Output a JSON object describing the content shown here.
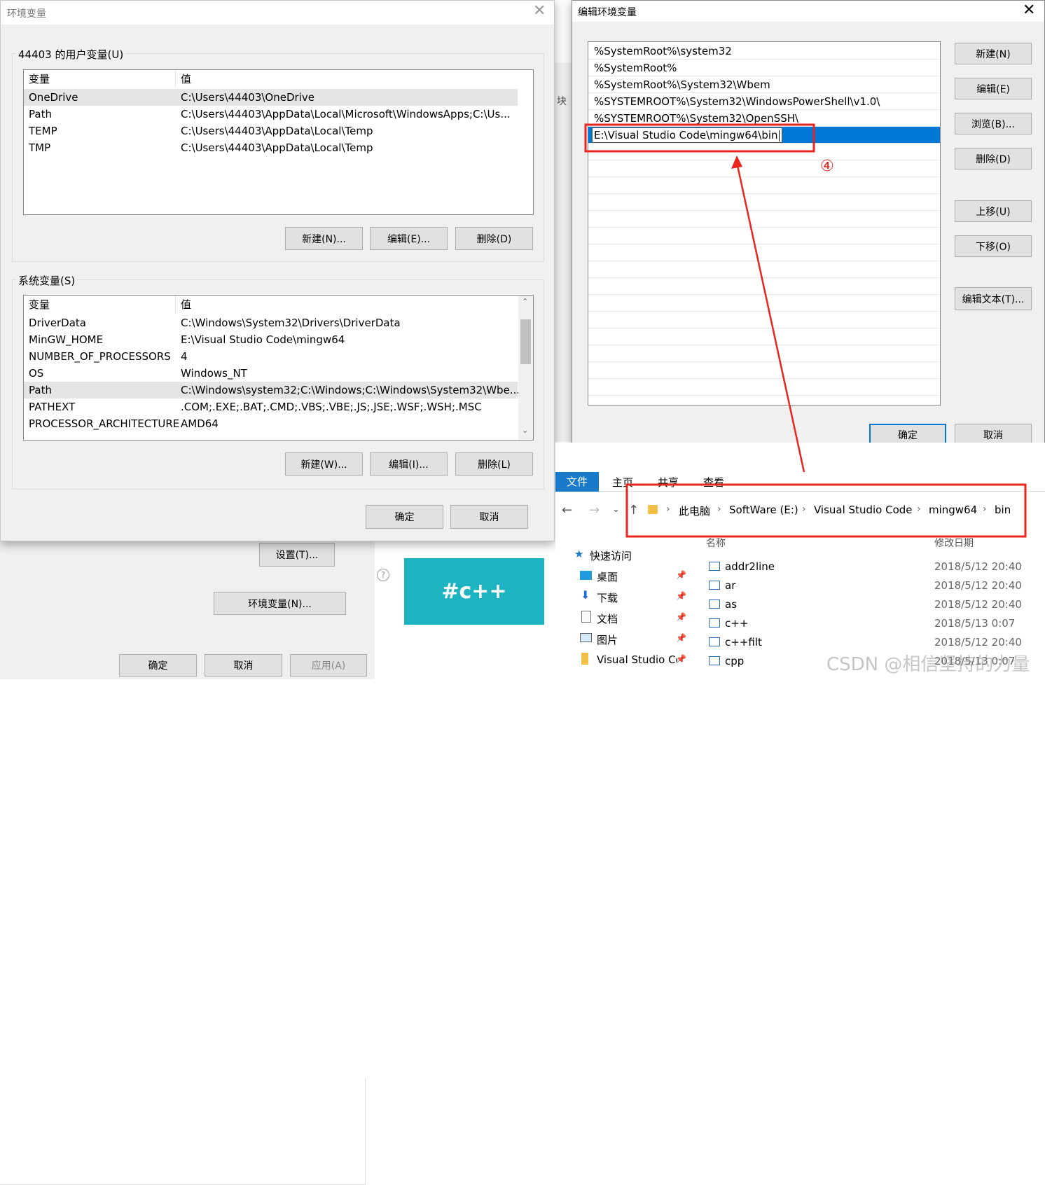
{
  "background": {
    "settings_button": "设置(T)...",
    "env_vars_button": "环境变量(N)...",
    "ok": "确定",
    "cancel": "取消",
    "apply": "应用(A)",
    "tile_text": "#c++",
    "strip_text": "块"
  },
  "env_dialog": {
    "title": "环境变量",
    "user_group_label": "44403 的用户变量(U)",
    "sys_group_label": "系统变量(S)",
    "col_var": "变量",
    "col_val": "值",
    "user_rows": [
      {
        "name": "OneDrive",
        "value": "C:\\Users\\44403\\OneDrive"
      },
      {
        "name": "Path",
        "value": "C:\\Users\\44403\\AppData\\Local\\Microsoft\\WindowsApps;C:\\Us..."
      },
      {
        "name": "TEMP",
        "value": "C:\\Users\\44403\\AppData\\Local\\Temp"
      },
      {
        "name": "TMP",
        "value": "C:\\Users\\44403\\AppData\\Local\\Temp"
      }
    ],
    "sys_rows": [
      {
        "name": "DriverData",
        "value": "C:\\Windows\\System32\\Drivers\\DriverData"
      },
      {
        "name": "MinGW_HOME",
        "value": "E:\\Visual Studio Code\\mingw64"
      },
      {
        "name": "NUMBER_OF_PROCESSORS",
        "value": "4"
      },
      {
        "name": "OS",
        "value": "Windows_NT"
      },
      {
        "name": "Path",
        "value": "C:\\Windows\\system32;C:\\Windows;C:\\Windows\\System32\\Wbe..."
      },
      {
        "name": "PATHEXT",
        "value": ".COM;.EXE;.BAT;.CMD;.VBS;.VBE;.JS;.JSE;.WSF;.WSH;.MSC"
      },
      {
        "name": "PROCESSOR_ARCHITECTURE",
        "value": "AMD64"
      }
    ],
    "user_new": "新建(N)...",
    "user_edit": "编辑(E)...",
    "user_delete": "删除(D)",
    "sys_new": "新建(W)...",
    "sys_edit": "编辑(I)...",
    "sys_delete": "删除(L)",
    "ok": "确定",
    "cancel": "取消"
  },
  "edit_dialog": {
    "title": "编辑环境变量",
    "entries": [
      "%SystemRoot%\\system32",
      "%SystemRoot%",
      "%SystemRoot%\\System32\\Wbem",
      "%SYSTEMROOT%\\System32\\WindowsPowerShell\\v1.0\\",
      "%SYSTEMROOT%\\System32\\OpenSSH\\"
    ],
    "editing_value": "E:\\Visual Studio Code\\mingw64\\bin",
    "new": "新建(N)",
    "edit": "编辑(E)",
    "browse": "浏览(B)...",
    "delete": "删除(D)",
    "move_up": "上移(U)",
    "move_down": "下移(O)",
    "edit_text": "编辑文本(T)...",
    "ok": "确定",
    "cancel": "取消"
  },
  "annotation": {
    "step_label": "④",
    "color": "#e8251f"
  },
  "explorer": {
    "tabs": [
      "文件",
      "主页",
      "共享",
      "查看"
    ],
    "breadcrumb": [
      "此电脑",
      "SoftWare (E:)",
      "Visual Studio Code",
      "mingw64",
      "bin"
    ],
    "col_name": "名称",
    "col_date": "修改日期",
    "quick_access": "快速访问",
    "nav_items": [
      "桌面",
      "下载",
      "文档",
      "图片",
      "Visual Studio Co"
    ],
    "files": [
      {
        "name": "addr2line",
        "date": "2018/5/12 20:40"
      },
      {
        "name": "ar",
        "date": "2018/5/12 20:40"
      },
      {
        "name": "as",
        "date": "2018/5/12 20:40"
      },
      {
        "name": "c++",
        "date": "2018/5/13 0:07"
      },
      {
        "name": "c++filt",
        "date": "2018/5/12 20:40"
      },
      {
        "name": "cpp",
        "date": "2018/5/13 0:07"
      }
    ]
  },
  "watermark": "CSDN @相信坚持的力量"
}
